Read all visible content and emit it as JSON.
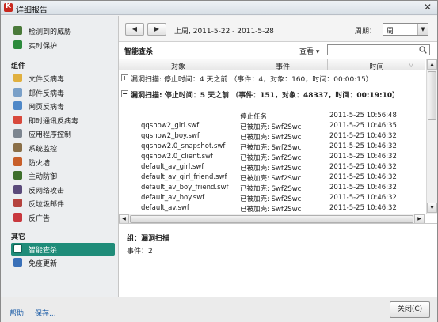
{
  "window": {
    "title": "详细报告"
  },
  "sidebar": {
    "top_items": [
      {
        "label": "检测到的威胁",
        "icon": "shield-icon",
        "color": "#4a7a3a"
      },
      {
        "label": "实时保护",
        "icon": "shield-icon",
        "color": "#2c8a3c"
      }
    ],
    "components_heading": "组件",
    "components": [
      {
        "label": "文件反病毒",
        "icon": "folder-icon",
        "color": "#e0b040"
      },
      {
        "label": "邮件反病毒",
        "icon": "mail-icon",
        "color": "#7aa0c8"
      },
      {
        "label": "网页反病毒",
        "icon": "globe-icon",
        "color": "#4f88c8"
      },
      {
        "label": "即时通讯反病毒",
        "icon": "chat-icon",
        "color": "#d8493c"
      },
      {
        "label": "应用程序控制",
        "icon": "filter-icon",
        "color": "#7d8690"
      },
      {
        "label": "系统监控",
        "icon": "gear-icon",
        "color": "#8a6f48"
      },
      {
        "label": "防火墙",
        "icon": "firewall-icon",
        "color": "#c85f2a"
      },
      {
        "label": "主动防御",
        "icon": "shield-icon",
        "color": "#3e6f2c"
      },
      {
        "label": "反网络攻击",
        "icon": "monitor-icon",
        "color": "#5a4a7a"
      },
      {
        "label": "反垃圾邮件",
        "icon": "spam-icon",
        "color": "#b5433e"
      },
      {
        "label": "反广告",
        "icon": "no-ads-icon",
        "color": "#c8383e"
      }
    ],
    "other_heading": "其它",
    "other": [
      {
        "label": "智能查杀",
        "icon": "scan-icon",
        "color": "#ffffff",
        "selected": true
      },
      {
        "label": "免疫更新",
        "icon": "update-icon",
        "color": "#3a70b8"
      }
    ],
    "selected_color": "#1f8c79"
  },
  "toolbar": {
    "back_arrow": "◀",
    "forward_arrow": "▶",
    "period_text": "上周, 2011-5-22 - 2011-5-28",
    "period_label": "周期：",
    "period_value": "周"
  },
  "panel": {
    "title": "智能查杀",
    "view_menu": "查看 ▾",
    "search_placeholder": ""
  },
  "table": {
    "columns": [
      "对象",
      "事件",
      "时间"
    ],
    "groups": [
      {
        "toggle": "+",
        "text": "漏洞扫描: 停止时间：4 天之前  （事件：4，对象：160，时间：00:00:15）",
        "bold": false
      },
      {
        "toggle": "−",
        "text": "漏洞扫描: 停止时间：5 天之前  （事件：151，对象：48337，时间：00:19:10）",
        "bold": true
      }
    ],
    "rows": [
      {
        "object": "",
        "event": "停止任务",
        "time": "2011-5-25 10:56:48"
      },
      {
        "object": "qqshow2_girl.swf",
        "event": "已被加壳: Swf2Swc",
        "time": "2011-5-25 10:46:35"
      },
      {
        "object": "qqshow2_boy.swf",
        "event": "已被加壳: Swf2Swc",
        "time": "2011-5-25 10:46:32"
      },
      {
        "object": "qqshow2.0_snapshot.swf",
        "event": "已被加壳: Swf2Swc",
        "time": "2011-5-25 10:46:32"
      },
      {
        "object": "qqshow2.0_client.swf",
        "event": "已被加壳: Swf2Swc",
        "time": "2011-5-25 10:46:32"
      },
      {
        "object": "default_av_girl.swf",
        "event": "已被加壳: Swf2Swc",
        "time": "2011-5-25 10:46:32"
      },
      {
        "object": "default_av_girl_friend.swf",
        "event": "已被加壳: Swf2Swc",
        "time": "2011-5-25 10:46:32"
      },
      {
        "object": "default_av_boy_friend.swf",
        "event": "已被加壳: Swf2Swc",
        "time": "2011-5-25 10:46:32"
      },
      {
        "object": "default_av_boy.swf",
        "event": "已被加壳: Swf2Swc",
        "time": "2011-5-25 10:46:32"
      },
      {
        "object": "default_av.swf",
        "event": "已被加壳: Swf2Swc",
        "time": "2011-5-25 10:46:32"
      }
    ]
  },
  "details": {
    "title": "组：漏洞扫描",
    "count": "事件：2"
  },
  "footer": {
    "help": "帮助",
    "save": "保存...",
    "close": "关闭(C)"
  }
}
